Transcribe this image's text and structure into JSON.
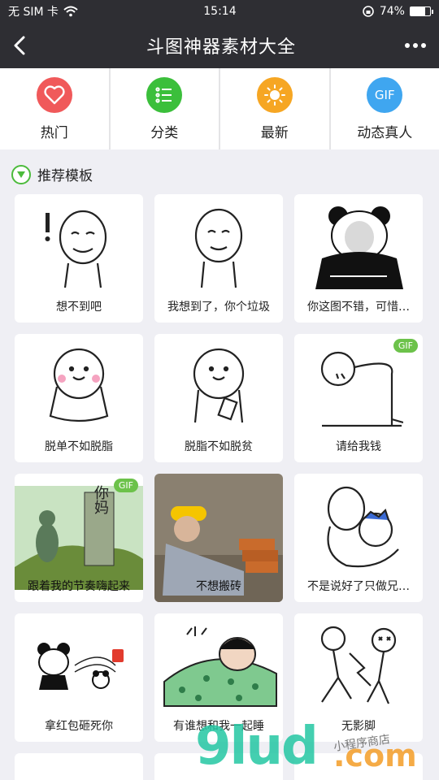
{
  "status": {
    "carrier": "无 SIM 卡",
    "time": "15:14",
    "battery": "74%",
    "battery_level": 0.74
  },
  "nav": {
    "title": "斗图神器素材大全"
  },
  "quick": [
    {
      "label": "热门",
      "color": "#f0595a",
      "icon": "heart"
    },
    {
      "label": "分类",
      "color": "#3bbf3b",
      "icon": "list"
    },
    {
      "label": "最新",
      "color": "#f6a623",
      "icon": "sun"
    },
    {
      "label": "动态真人",
      "color": "#3fa6f0",
      "icon": "gif",
      "icon_text": "GIF"
    }
  ],
  "section": {
    "title": "推荐模板"
  },
  "cards": [
    {
      "caption": "想不到吧",
      "art": "face-exclaim"
    },
    {
      "caption": "我想到了，你个垃圾",
      "art": "face"
    },
    {
      "caption": "你这图不错，可惜…",
      "art": "panda"
    },
    {
      "caption": "脱单不如脱脂",
      "art": "blush"
    },
    {
      "caption": "脱脂不如脱贫",
      "art": "blush-phone"
    },
    {
      "caption": "请给我钱",
      "art": "bow",
      "gif": "GIF"
    },
    {
      "caption": "跟着我的节奏嗨起来",
      "art": "photo-green",
      "gif": "GIF",
      "art_text": "你妈"
    },
    {
      "caption": "不想搬砖",
      "art": "photo-worker"
    },
    {
      "caption": "不是说好了只做兄…",
      "art": "hug"
    },
    {
      "caption": "拿红包砸死你",
      "art": "panda-throw"
    },
    {
      "caption": "有谁想和我一起睡",
      "art": "sleep"
    },
    {
      "caption": "无影脚",
      "art": "kick"
    }
  ],
  "watermark": {
    "text": "9lud",
    "dot": ".com",
    "hand": "小程序商店"
  }
}
